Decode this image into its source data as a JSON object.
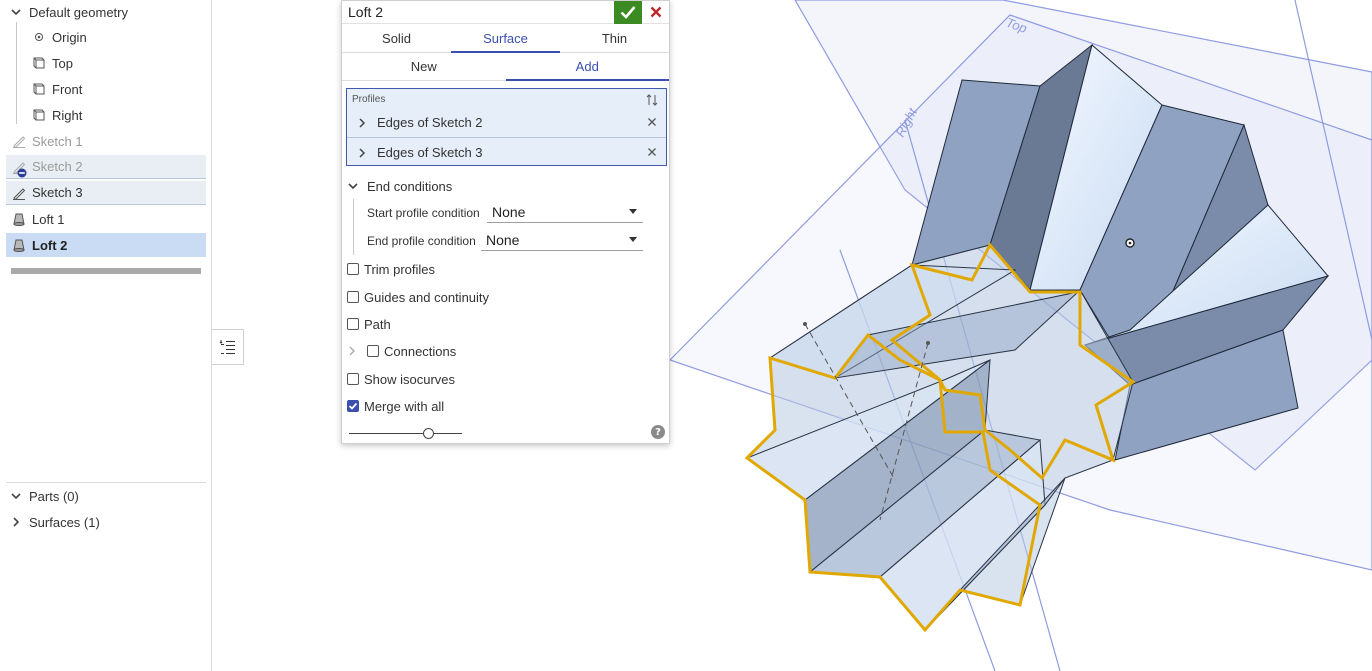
{
  "feature_tree": {
    "default_geometry_label": "Default geometry",
    "planes": [
      {
        "label": "Origin",
        "icon": "origin-point-icon"
      },
      {
        "label": "Top",
        "icon": "plane-icon"
      },
      {
        "label": "Front",
        "icon": "plane-icon"
      },
      {
        "label": "Right",
        "icon": "plane-icon"
      }
    ],
    "features": [
      {
        "label": "Sketch 1",
        "icon": "sketch-icon",
        "state": "suppressed"
      },
      {
        "label": "Sketch 2",
        "icon": "sketch-icon",
        "state": "suppressed"
      },
      {
        "label": "Sketch 3",
        "icon": "sketch-icon",
        "state": "selected-light"
      },
      {
        "label": "Loft 1",
        "icon": "loft-icon",
        "state": "normal"
      },
      {
        "label": "Loft 2",
        "icon": "loft-icon",
        "state": "selected"
      }
    ],
    "parts_label": "Parts (0)",
    "surfaces_label": "Surfaces (1)"
  },
  "dialog": {
    "title": "Loft 2",
    "creation_tabs": [
      "Solid",
      "Surface",
      "Thin"
    ],
    "active_creation_tab": "Surface",
    "operation_tabs": [
      "New",
      "Add"
    ],
    "active_operation_tab": "Add",
    "profiles_label": "Profiles",
    "profiles": [
      "Edges of Sketch 2",
      "Edges of Sketch 3"
    ],
    "end_conditions_label": "End conditions",
    "start_profile_label": "Start profile condition",
    "start_profile_value": "None",
    "end_profile_label": "End profile condition",
    "end_profile_value": "None",
    "trim_profiles_label": "Trim profiles",
    "trim_profiles_checked": false,
    "guides_label": "Guides and continuity",
    "guides_checked": false,
    "path_label": "Path",
    "path_checked": false,
    "connections_label": "Connections",
    "connections_checked": false,
    "isocurves_label": "Show isocurves",
    "isocurves_checked": false,
    "merge_label": "Merge with all",
    "merge_checked": true,
    "slider_level": 0.7,
    "help_glyph": "?"
  },
  "viewport": {
    "plane_labels": [
      "Top",
      "Right"
    ],
    "highlight_color": "#e0a800",
    "plane_color": "#8f9be0"
  },
  "colors": {
    "accent": "#3b4fae",
    "ok_green": "#3b8a22",
    "cancel_red": "#c0282d",
    "selection": "#c9dcf4"
  }
}
